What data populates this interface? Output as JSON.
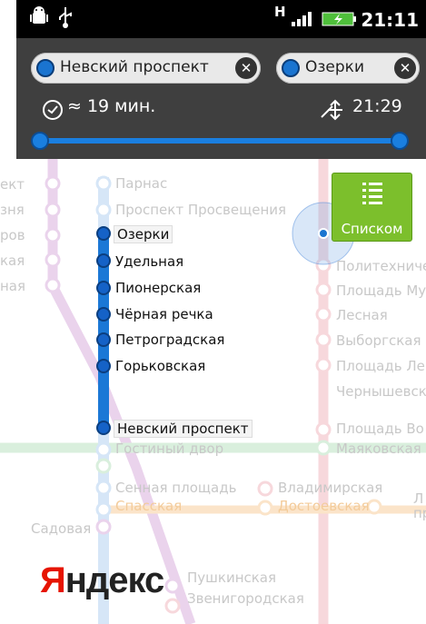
{
  "status": {
    "time": "21:11",
    "net_icon": "H"
  },
  "route": {
    "from": "Невский проспект",
    "to": "Озерки",
    "duration": "≈ 19 мин.",
    "arrival": "21:29"
  },
  "list_button": {
    "label": "Списком"
  },
  "logo": {
    "first": "Я",
    "rest": "ндекс"
  },
  "map": {
    "route_stations": [
      "Озерки",
      "Удельная",
      "Пионерская",
      "Чёрная речка",
      "Петроградская",
      "Горьковская"
    ],
    "origin_station": "Невский проспект",
    "blue_faded": [
      "Парнас",
      "Проспект Просвещения"
    ],
    "red_line": [
      "Политехниче",
      "Площадь Му",
      "Лесная",
      "Выборгская",
      "Площадь Ле",
      "Чернышевск",
      "Площадь Во",
      "Маяковская"
    ],
    "left_fragments": [
      "ект",
      "зня",
      "ров",
      "кая",
      "ная"
    ],
    "others": {
      "gostiny": "Гостиный двор",
      "sennaya": "Сенная площадь",
      "spasskaya": "Спасская",
      "sadovaya": "Садовая",
      "vladimirskaya": "Владимирская",
      "dostoevskaya": "Достоевская",
      "pushkinskaya": "Пушкинская",
      "zvenigorodskaya": "Звенигородская",
      "ki": "ки",
      "l": "Л",
      "pr": "пр"
    }
  }
}
